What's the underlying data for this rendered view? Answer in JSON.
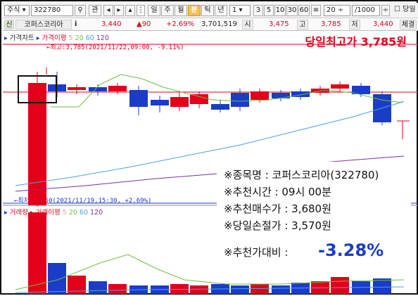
{
  "toolbar": {
    "market": "주식",
    "code": "322780",
    "btn_gwan": "관",
    "periods": [
      "일",
      "주",
      "월",
      "분",
      "틱",
      "년"
    ],
    "period_selected": "분",
    "interval_value": "1",
    "intervals": [
      "3",
      "5",
      "10",
      "30",
      "60"
    ],
    "zoom_value": "20",
    "count_value": "1000",
    "checkbox_label": "당일"
  },
  "quote": {
    "flag": "신",
    "name": "코퍼스코리아",
    "info": "i",
    "price": "3,440",
    "change": "▲90",
    "change_pct": "+2.69%",
    "volume": "3,701,519",
    "open_label": "시",
    "open": "3,475",
    "high_label": "고",
    "high": "3,785",
    "low_label": "저",
    "low": "3,440",
    "exec_label": "체결"
  },
  "price_panel": {
    "title": "가격차트",
    "ma_label": "가격이평",
    "ma_periods": [
      "5",
      "20",
      "60",
      "120"
    ],
    "max_note": "←최고:3,785(2021/11/22,09:00, -9.11%)",
    "min_note": "←최저:3,350(2021/11/19,15:30, +2.69%)",
    "headline": "당일최고가 3,785원"
  },
  "volume_panel": {
    "title": "거래량",
    "ma_label": "거래이평",
    "ma_periods": [
      "5",
      "20",
      "60",
      "120"
    ]
  },
  "info": {
    "line1": "※종목명 : 코퍼스코리아(322780)",
    "line2": "※추천시간 : 09시 00분",
    "line3": "※추천매수가 : 3,680원",
    "line4": "※당일손절가 : 3,570원",
    "line5_label": "※추천가대비 :",
    "line5_value": "-3.28%"
  },
  "colors": {
    "up": "#e2001a",
    "down": "#1a3cc8",
    "ma5": "#e89a9a",
    "ma20": "#6bbf3e",
    "ma60": "#4aa3df",
    "ma120": "#7a2ea8"
  },
  "chart_data": {
    "type": "candlestick",
    "price_levels": {
      "high": 3785,
      "low": 3350
    },
    "candles": [
      {
        "dir": "up"
      },
      {
        "dir": "down"
      },
      {
        "dir": "up"
      },
      {
        "dir": "down"
      },
      {
        "dir": "up"
      },
      {
        "dir": "down"
      },
      {
        "dir": "down"
      },
      {
        "dir": "up"
      },
      {
        "dir": "up"
      },
      {
        "dir": "down"
      },
      {
        "dir": "down"
      },
      {
        "dir": "up"
      },
      {
        "dir": "down"
      },
      {
        "dir": "down"
      },
      {
        "dir": "up"
      },
      {
        "dir": "up"
      },
      {
        "dir": "down"
      },
      {
        "dir": "down"
      }
    ]
  }
}
